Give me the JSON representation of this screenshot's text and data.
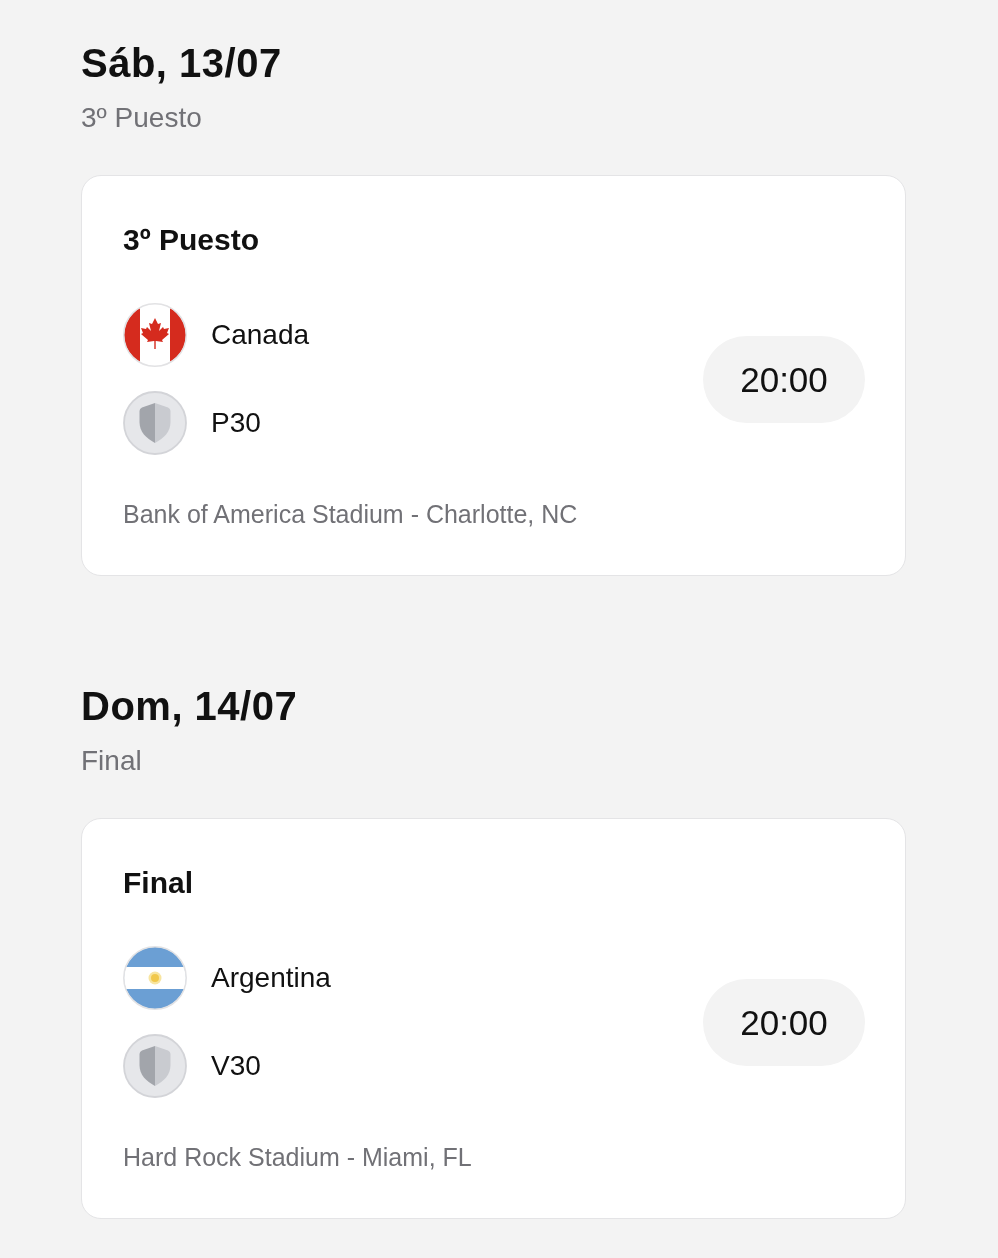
{
  "days": [
    {
      "date": "Sáb, 13/07",
      "stage": "3º Puesto",
      "matches": [
        {
          "title": "3º Puesto",
          "teams": [
            {
              "name": "Canada",
              "kind": "canada"
            },
            {
              "name": "P30",
              "kind": "placeholder"
            }
          ],
          "time": "20:00",
          "venue": "Bank of America Stadium - Charlotte, NC"
        }
      ]
    },
    {
      "date": "Dom, 14/07",
      "stage": "Final",
      "matches": [
        {
          "title": "Final",
          "teams": [
            {
              "name": "Argentina",
              "kind": "argentina"
            },
            {
              "name": "V30",
              "kind": "placeholder"
            }
          ],
          "time": "20:00",
          "venue": "Hard Rock Stadium - Miami, FL"
        }
      ]
    }
  ]
}
